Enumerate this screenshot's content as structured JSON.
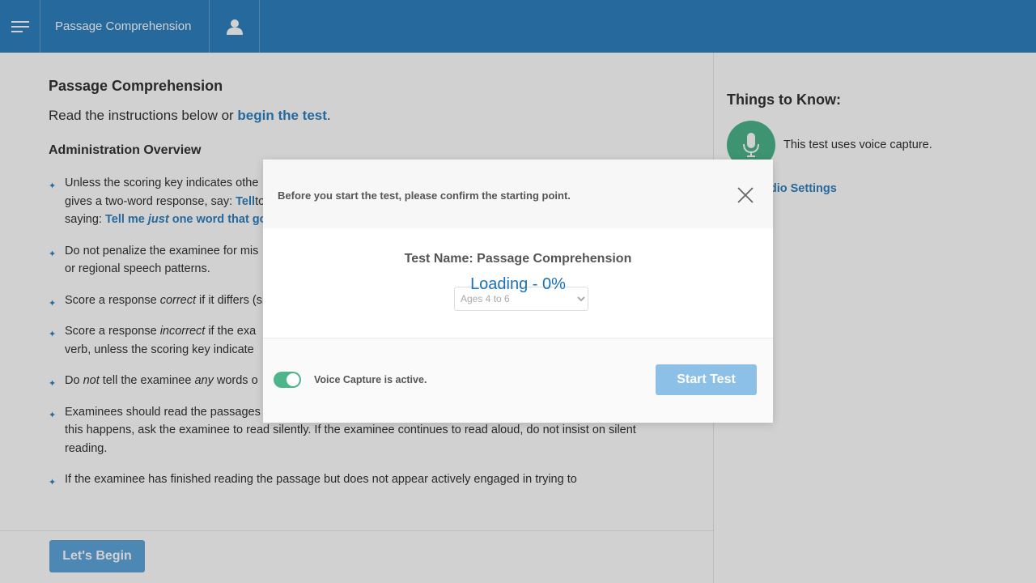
{
  "topbar": {
    "breadcrumb": "Passage Comprehension"
  },
  "main": {
    "title": "Passage Comprehension",
    "intro_text": "Read the instructions below or ",
    "intro_link": "begin the test",
    "intro_end": ".",
    "overview_heading": "Administration Overview",
    "items": [
      {
        "segments": [
          {
            "t": "Unless the scoring key indicates othe",
            "s": "plain"
          },
          {
            "t": "gives a two-word response, say: ",
            "s": "plain"
          },
          {
            "t": "Tell",
            "s": "hl"
          },
          {
            "t": "to this query by saying a word that is",
            "s": "plain"
          },
          {
            "t": "saying: ",
            "s": "plain"
          },
          {
            "t": "Tell me ",
            "s": "hl"
          },
          {
            "t": "just",
            "s": "hl-it"
          },
          {
            "t": " one word that go",
            "s": "hl"
          }
        ]
      },
      {
        "segments": [
          {
            "t": "Do not penalize the examinee for mis",
            "s": "plain"
          },
          {
            "t": "or regional speech patterns.",
            "s": "plain"
          }
        ]
      },
      {
        "segments": [
          {
            "t": "Score a response ",
            "s": "plain"
          },
          {
            "t": "correct",
            "s": "it"
          },
          {
            "t": " if it differs ",
            "s": "plain"
          },
          {
            "t": "(singular/plural), unless the scoring k",
            "s": "plain"
          }
        ]
      },
      {
        "segments": [
          {
            "t": "Score a response ",
            "s": "plain"
          },
          {
            "t": "incorrect",
            "s": "it"
          },
          {
            "t": " if the exa",
            "s": "plain"
          },
          {
            "t": "verb, unless the scoring key indicate",
            "s": "plain"
          }
        ]
      },
      {
        "segments": [
          {
            "t": "Do ",
            "s": "plain"
          },
          {
            "t": "not",
            "s": "it"
          },
          {
            "t": " tell the examinee ",
            "s": "plain"
          },
          {
            "t": "any",
            "s": "it"
          },
          {
            "t": " words o",
            "s": "plain"
          }
        ]
      },
      {
        "segments": [
          {
            "t": "Examinees should read the passages silently. Some examinees, especially younger ones, may read aloud. If this happens, ask the examinee to read silently. If the examinee continues to read aloud, do not insist on silent reading.",
            "s": "plain"
          }
        ]
      },
      {
        "segments": [
          {
            "t": "If the examinee has finished reading the passage but does not appear actively engaged in trying to",
            "s": "plain"
          }
        ]
      }
    ],
    "bullet_glyph": "✦"
  },
  "sidebar": {
    "title": "Things to Know:",
    "voice_note": "This test uses voice capture.",
    "audio_link": "udio Settings",
    "mic_icon": "microphone-icon"
  },
  "bottombar": {
    "begin_label": "Let's Begin"
  },
  "modal": {
    "message": "Before you start the test, please confirm the starting point.",
    "test_name": "Test Name: Passage Comprehension",
    "loading": "Loading - 0%",
    "select_value": "Ages 4 to 6",
    "voice_status": "Voice Capture is active.",
    "voice_toggle_on": true,
    "start_label": "Start Test"
  },
  "colors": {
    "brand_blue": "#2f80c0",
    "green": "#4cb58a",
    "start_button": "#8cc0e6"
  }
}
